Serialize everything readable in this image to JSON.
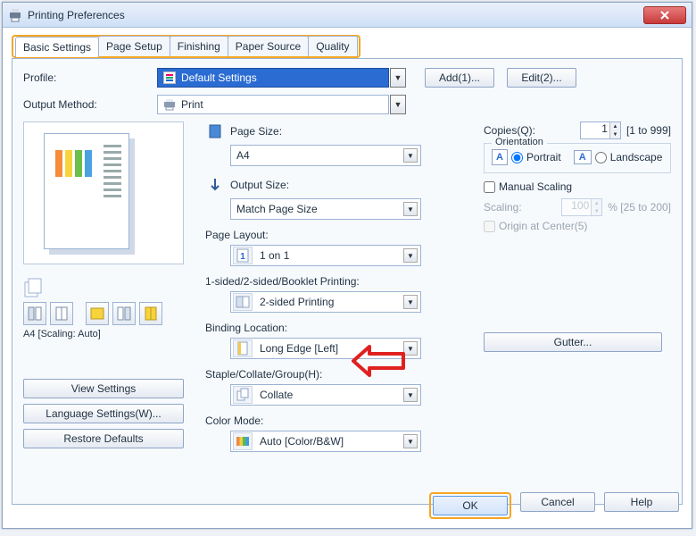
{
  "window": {
    "title": "Printing Preferences"
  },
  "tabs": {
    "items": [
      "Basic Settings",
      "Page Setup",
      "Finishing",
      "Paper Source",
      "Quality"
    ],
    "active_index": 0
  },
  "profile": {
    "label": "Profile:",
    "value": "Default Settings",
    "add_btn": "Add(1)...",
    "edit_btn": "Edit(2)..."
  },
  "output_method": {
    "label": "Output Method:",
    "value": "Print"
  },
  "preview": {
    "caption": "A4 [Scaling: Auto]"
  },
  "side_buttons": {
    "view": "View Settings",
    "lang": "Language Settings(W)...",
    "restore": "Restore Defaults"
  },
  "settings": {
    "page_size": {
      "label": "Page Size:",
      "value": "A4"
    },
    "output_size": {
      "label": "Output Size:",
      "value": "Match Page Size"
    },
    "page_layout": {
      "label": "Page Layout:",
      "value": "1 on 1"
    },
    "duplex": {
      "label": "1-sided/2-sided/Booklet Printing:",
      "value": "2-sided Printing"
    },
    "binding": {
      "label": "Binding Location:",
      "value": "Long Edge [Left]"
    },
    "staple": {
      "label": "Staple/Collate/Group(H):",
      "value": "Collate"
    },
    "color": {
      "label": "Color Mode:",
      "value": "Auto [Color/B&W]"
    }
  },
  "right": {
    "copies_label": "Copies(Q):",
    "copies_value": "1",
    "copies_range": "[1 to 999]",
    "orientation": {
      "label": "Orientation",
      "portrait": "Portrait",
      "landscape": "Landscape",
      "selected": "portrait"
    },
    "manual_scaling": "Manual Scaling",
    "scaling_label": "Scaling:",
    "scaling_value": "100",
    "scaling_range": "% [25 to 200]",
    "origin": "Origin at Center(5)",
    "gutter_btn": "Gutter..."
  },
  "footer": {
    "ok": "OK",
    "cancel": "Cancel",
    "help": "Help"
  }
}
